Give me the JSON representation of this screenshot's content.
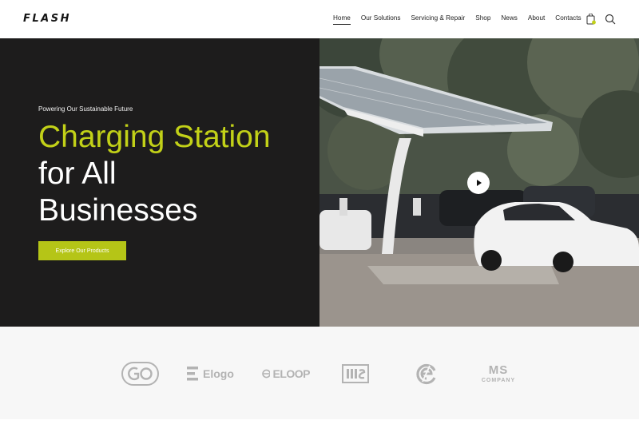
{
  "header": {
    "logo": "FLASH",
    "nav": [
      {
        "label": "Home",
        "active": true
      },
      {
        "label": "Our Solutions"
      },
      {
        "label": "Servicing & Repair"
      },
      {
        "label": "Shop"
      },
      {
        "label": "News"
      },
      {
        "label": "About"
      },
      {
        "label": "Contacts"
      }
    ],
    "icons": [
      "cart-icon",
      "search-icon"
    ]
  },
  "hero": {
    "eyebrow": "Powering Our Sustainable Future",
    "title_line1": "Charging Station",
    "title_line2": "for All",
    "title_line3": "Businesses",
    "cta": "Explore Our Products",
    "colors": {
      "accent": "#c2d118",
      "button": "#b5c517",
      "panel": "#1d1c1c"
    }
  },
  "partners": [
    {
      "name": "GO",
      "icon": "go-logo"
    },
    {
      "name": "Elogo",
      "icon": "elogo-logo"
    },
    {
      "name": "ELOOP",
      "icon": "eloop-logo"
    },
    {
      "name": "MS",
      "icon": "ms-boxed-logo"
    },
    {
      "name": "e",
      "icon": "e-circle-logo"
    },
    {
      "name": "MS COMPANY",
      "mark": "MS",
      "sub": "COMPANY",
      "icon": "ms-company-logo"
    }
  ]
}
